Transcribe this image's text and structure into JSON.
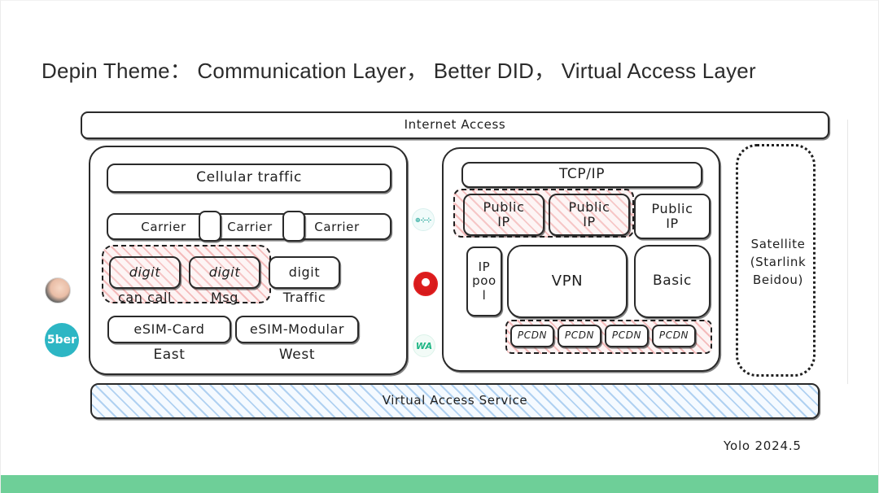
{
  "title": "Depin Theme： Communication Layer， Better DID， Virtual Access Layer",
  "signature": "Yolo 2024.5",
  "colors": {
    "footer_green": "#6ecf98",
    "hatch_pink": "#e76e6e",
    "hatch_blue": "#78afe6",
    "ink": "#1f1f1f",
    "avatar_teal": "#2db6c4",
    "logo_red": "#e01f20"
  },
  "diagram": {
    "top_bar": {
      "label": "Internet Access"
    },
    "bottom_bar": {
      "label": "Virtual Access Service"
    },
    "left_panel": {
      "cellular": {
        "label": "Cellular traffic"
      },
      "carriers": [
        {
          "label": "Carrier"
        },
        {
          "label": "Carrier"
        },
        {
          "label": "Carrier"
        }
      ],
      "carrier_gaps": [
        {
          "label": ""
        },
        {
          "label": ""
        }
      ],
      "digits": [
        {
          "label": "digit",
          "caption": "can call",
          "highlighted": true
        },
        {
          "label": "digit",
          "caption": "Msg",
          "highlighted": true
        },
        {
          "label": "digit",
          "caption": "Traffic",
          "highlighted": false
        }
      ],
      "esim": [
        {
          "label": "eSIM-Card",
          "caption": "East"
        },
        {
          "label": "eSIM-Modular",
          "caption": "West"
        }
      ]
    },
    "middle_logos": [
      {
        "name": "teal-ring-logo",
        "label": "⊕⊹⊹"
      },
      {
        "name": "red-circle-logo",
        "label": ""
      },
      {
        "name": "green-wave-logo",
        "label": "WA"
      }
    ],
    "side_avatars": [
      {
        "name": "profile-photo-avatar",
        "label": ""
      },
      {
        "name": "5ber-logo-avatar",
        "label": "5ber"
      }
    ],
    "right_panel": {
      "tcpip": {
        "label": "TCP/IP"
      },
      "public_ips": [
        {
          "label": "Public\nIP",
          "highlighted": true
        },
        {
          "label": "Public\nIP",
          "highlighted": true
        },
        {
          "label": "Public\nIP",
          "highlighted": false
        }
      ],
      "ip_pool": {
        "label": "IP\npoo\nl"
      },
      "vpn": {
        "label": "VPN"
      },
      "basic": {
        "label": "Basic"
      },
      "pcdn": [
        {
          "label": "PCDN"
        },
        {
          "label": "PCDN"
        },
        {
          "label": "PCDN"
        },
        {
          "label": "PCDN"
        }
      ]
    },
    "satellite_panel": {
      "label": "Satellite\n(Starlink\nBeidou)"
    }
  }
}
